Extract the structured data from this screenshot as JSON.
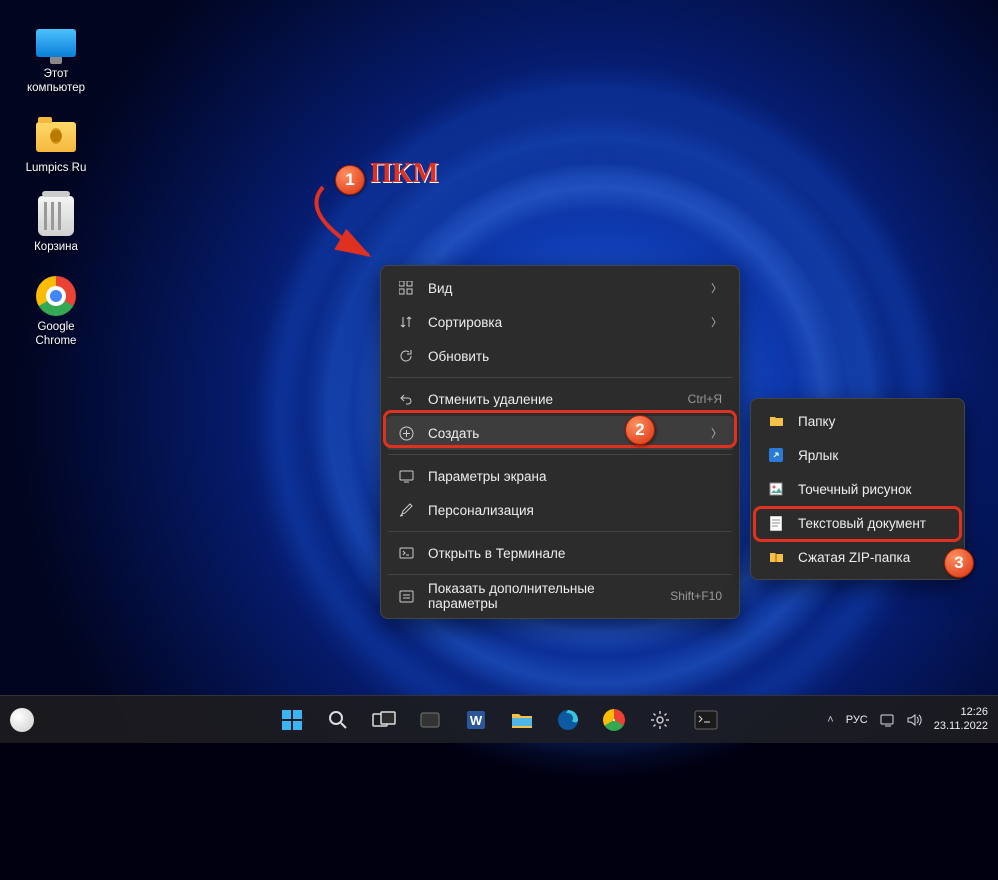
{
  "desktop_icons": [
    {
      "id": "this-pc",
      "label": "Этот\nкомпьютер"
    },
    {
      "id": "lumpics",
      "label": "Lumpics Ru"
    },
    {
      "id": "recycle",
      "label": "Корзина"
    },
    {
      "id": "chrome",
      "label": "Google\nChrome"
    }
  ],
  "annotation": {
    "text": "ПКМ",
    "badge1": "1",
    "badge2": "2",
    "badge3": "3"
  },
  "context_menu": {
    "view": {
      "label": "Вид"
    },
    "sort": {
      "label": "Сортировка"
    },
    "refresh": {
      "label": "Обновить"
    },
    "undo": {
      "label": "Отменить удаление",
      "accel": "Ctrl+Я"
    },
    "new": {
      "label": "Создать"
    },
    "display": {
      "label": "Параметры экрана"
    },
    "personalize": {
      "label": "Персонализация"
    },
    "terminal": {
      "label": "Открыть в Терминале"
    },
    "more": {
      "label": "Показать дополнительные параметры",
      "accel": "Shift+F10"
    }
  },
  "submenu": {
    "folder": {
      "label": "Папку"
    },
    "shortcut": {
      "label": "Ярлык"
    },
    "bitmap": {
      "label": "Точечный рисунок"
    },
    "txt": {
      "label": "Текстовый документ"
    },
    "zip": {
      "label": "Сжатая ZIP-папка"
    }
  },
  "taskbar": {
    "lang": "РУС",
    "time": "12:26",
    "date": "23.11.2022"
  }
}
